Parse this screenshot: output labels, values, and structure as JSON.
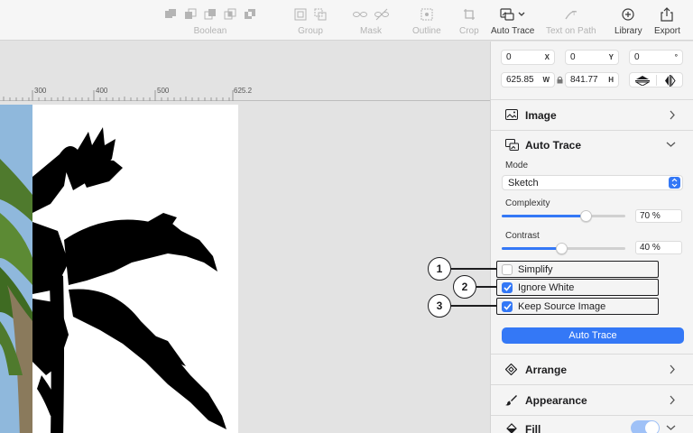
{
  "toolbar": {
    "boolean_label": "Boolean",
    "group_label": "Group",
    "mask_label": "Mask",
    "outline_label": "Outline",
    "crop_label": "Crop",
    "auto_trace_label": "Auto Trace",
    "text_on_path_label": "Text on Path",
    "library_label": "Library",
    "export_label": "Export"
  },
  "ruler": {
    "ticks": [
      "300",
      "400",
      "500",
      "625.2"
    ]
  },
  "inspector": {
    "x_value": "0",
    "x_unit": "X",
    "y_value": "0",
    "y_unit": "Y",
    "rotation_value": "0",
    "rotation_unit": "°",
    "w_value": "625.85",
    "w_unit": "W",
    "h_value": "841.77",
    "h_unit": "H",
    "image_section": "Image",
    "auto_trace_section": "Auto Trace",
    "mode_label": "Mode",
    "mode_value": "Sketch",
    "complexity_label": "Complexity",
    "complexity_value": "70 %",
    "complexity_level": 0.7,
    "contrast_label": "Contrast",
    "contrast_value": "40 %",
    "contrast_level": 0.48,
    "options": [
      {
        "label": "Simplify",
        "checked": false
      },
      {
        "label": "Ignore White",
        "checked": true
      },
      {
        "label": "Keep Source Image",
        "checked": true
      }
    ],
    "auto_trace_button": "Auto Trace",
    "arrange_section": "Arrange",
    "appearance_section": "Appearance",
    "fill_section": "Fill"
  },
  "callouts": [
    "1",
    "2",
    "3"
  ],
  "colors": {
    "accent": "#3478f6",
    "toggle_on": "#9fc1f7"
  }
}
